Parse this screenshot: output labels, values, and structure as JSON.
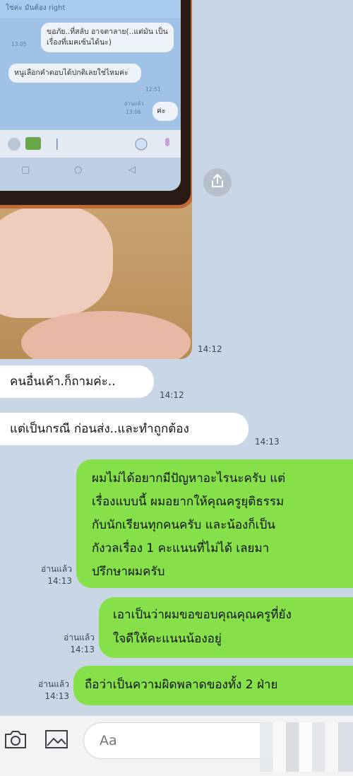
{
  "photo": {
    "screen_header": "ใช่ค่ะ มันต้อง right",
    "messages": [
      {
        "text": "ขอภัย..ที่สลับ อาจตาลาย(..แต่มัน เป็นเรื่องที่เมคเซ้นได้นะ)",
        "time": "13:05",
        "side": "out"
      },
      {
        "text": "หนูเลือกคำตอบได้ปกติเลยใช่ไหมค่ะ",
        "time": "12:51",
        "side": "in"
      },
      {
        "text": "ค่ะ",
        "read": "อ่านแล้ว",
        "time": "13:06",
        "side": "out"
      }
    ]
  },
  "share_icon": "share-icon",
  "chat": {
    "messages": [
      {
        "side": "in",
        "text": "คนอื่นเค้า.ก็ถามค่ะ..",
        "time": "14:12"
      },
      {
        "side": "in",
        "text": "แต่เป็นกรณี ก่อนส่ง..และทำถูกต้อง",
        "time": "14:13"
      },
      {
        "side": "out",
        "lines": [
          "ผมไม่ได้อยากมีปัญหาอะไรนะครับ แต่",
          "เรื่องแบบนี้ ผมอยากให้คุณครูยุติธรรม",
          "กับนักเรียนทุกคนครับ และน้องก็เป็น",
          "กังวลเรื่อง 1 คะแนนที่ไม่ได้ เลยมา",
          "ปรึกษาผมครับ"
        ],
        "read": "อ่านแล้ว",
        "time": "14:13"
      },
      {
        "side": "out",
        "lines": [
          "เอาเป็นว่าผมขอขอบคุณคุณครูที่ยัง",
          "ใจดีให้คะแนนน้องอยู่"
        ],
        "read": "อ่านแล้ว",
        "time": "14:13"
      },
      {
        "side": "out",
        "lines": [
          "ถือว่าเป็นความผิดพลาดของทั้ง 2 ฝ่าย"
        ],
        "read": "อ่านแล้ว",
        "time": "14:13"
      }
    ],
    "photo_time": "14:12"
  },
  "input": {
    "placeholder": "Aa",
    "camera_icon": "camera-icon",
    "image_icon": "image-icon"
  },
  "colors": {
    "background": "#c9d6e6",
    "outgoing": "#85e04a",
    "incoming": "#ffffff"
  }
}
